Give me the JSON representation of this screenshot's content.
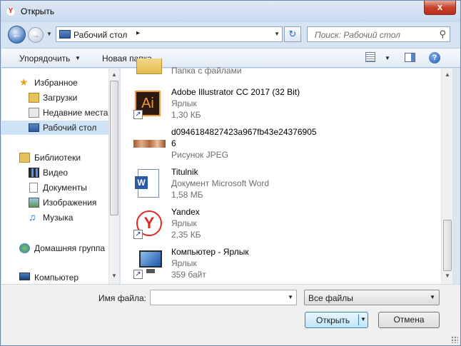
{
  "window": {
    "title": "Открыть",
    "close_label": "x",
    "app_icon_letter": "Y"
  },
  "address": {
    "path": "Рабочий стол",
    "search_placeholder": "Поиск: Рабочий стол"
  },
  "toolbar": {
    "organize_label": "Упорядочить",
    "new_folder_label": "Новая папка"
  },
  "navpane": {
    "items": [
      {
        "label": "Избранное",
        "icon": "star-icon",
        "level": 0
      },
      {
        "label": "Загрузки",
        "icon": "downloads-icon",
        "level": 1
      },
      {
        "label": "Недавние места",
        "icon": "recent-places-icon",
        "level": 1
      },
      {
        "label": "Рабочий стол",
        "icon": "desktop-icon",
        "level": 1,
        "selected": true
      },
      {
        "label": "Библиотеки",
        "icon": "libraries-icon",
        "level": 0
      },
      {
        "label": "Видео",
        "icon": "video-icon",
        "level": 1
      },
      {
        "label": "Документы",
        "icon": "documents-icon",
        "level": 1
      },
      {
        "label": "Изображения",
        "icon": "images-icon",
        "level": 1
      },
      {
        "label": "Музыка",
        "icon": "music-icon",
        "level": 1
      },
      {
        "label": "Домашняя группа",
        "icon": "homegroup-icon",
        "level": 0
      },
      {
        "label": "Компьютер",
        "icon": "computer-icon",
        "level": 0
      }
    ]
  },
  "files": [
    {
      "name": "",
      "type": "Папка с файлами",
      "size": "",
      "icon": "folder-icon"
    },
    {
      "name": "Adobe Illustrator CC 2017 (32 Bit)",
      "type": "Ярлык",
      "size": "1,30 КБ",
      "icon": "illustrator-icon",
      "ai_label": "Ai"
    },
    {
      "name": "d0946184827423a967fb43e243769056",
      "name_line1": "d0946184827423a967fb43e24376905",
      "name_line2": "6",
      "type": "Рисунок JPEG",
      "size": "",
      "icon": "image-thumbnail-icon"
    },
    {
      "name": "Titulnik",
      "type": "Документ Microsoft Word",
      "size": "1,58 МБ",
      "icon": "word-doc-icon",
      "word_label": "W"
    },
    {
      "name": "Yandex",
      "type": "Ярлык",
      "size": "2,35 КБ",
      "icon": "yandex-icon",
      "yandex_label": "Y"
    },
    {
      "name": "Компьютер - Ярлык",
      "type": "Ярлык",
      "size": "359 байт",
      "icon": "computer-icon"
    }
  ],
  "bottom": {
    "filename_label": "Имя файла:",
    "filename_value": "",
    "filetype_value": "Все файлы",
    "open_label": "Открыть",
    "cancel_label": "Отмена"
  }
}
